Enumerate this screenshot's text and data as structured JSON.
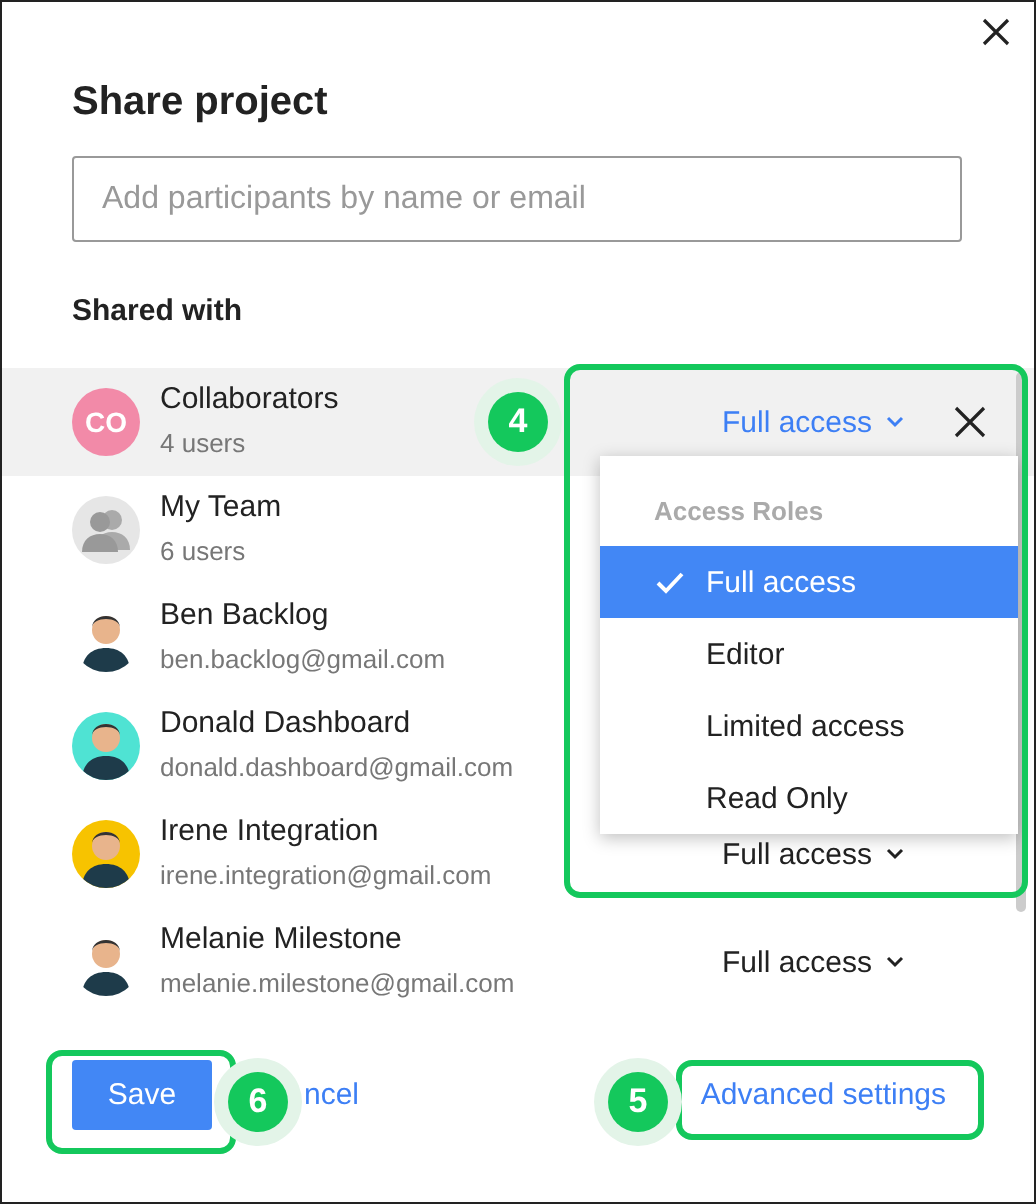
{
  "dialog": {
    "title": "Share project"
  },
  "search": {
    "placeholder": "Add participants by name or email"
  },
  "section_title": "Shared with",
  "participants": [
    {
      "kind": "initials",
      "initials": "CO",
      "color": "#f28aa8",
      "name": "Collaborators",
      "detail": "4 users",
      "access": "Full access",
      "open": true
    },
    {
      "kind": "group",
      "color": "#e6e6e6",
      "name": "My Team",
      "detail": "6 users",
      "open": false
    },
    {
      "kind": "person",
      "color": "#ffffff",
      "name": "Ben Backlog",
      "detail": "ben.backlog@gmail.com",
      "open": false
    },
    {
      "kind": "person",
      "color": "#4fe3d3",
      "name": "Donald Dashboard",
      "detail": "donald.dashboard@gmail.com",
      "open": false
    },
    {
      "kind": "person",
      "color": "#f7c300",
      "name": "Irene Integration",
      "detail": "irene.integration@gmail.com",
      "access": "Full access",
      "open": false
    },
    {
      "kind": "person",
      "color": "#ffffff",
      "name": "Melanie Milestone",
      "detail": "melanie.milestone@gmail.com",
      "access": "Full access",
      "open": false
    }
  ],
  "dropdown": {
    "header": "Access Roles",
    "options": [
      {
        "label": "Full access",
        "selected": true
      },
      {
        "label": "Editor",
        "selected": false
      },
      {
        "label": "Limited access",
        "selected": false
      },
      {
        "label": "Read Only",
        "selected": false
      }
    ]
  },
  "footer": {
    "save": "Save",
    "cancel": "ncel",
    "advanced": "Advanced settings"
  },
  "callouts": [
    {
      "number": "4"
    },
    {
      "number": "5"
    },
    {
      "number": "6"
    }
  ]
}
